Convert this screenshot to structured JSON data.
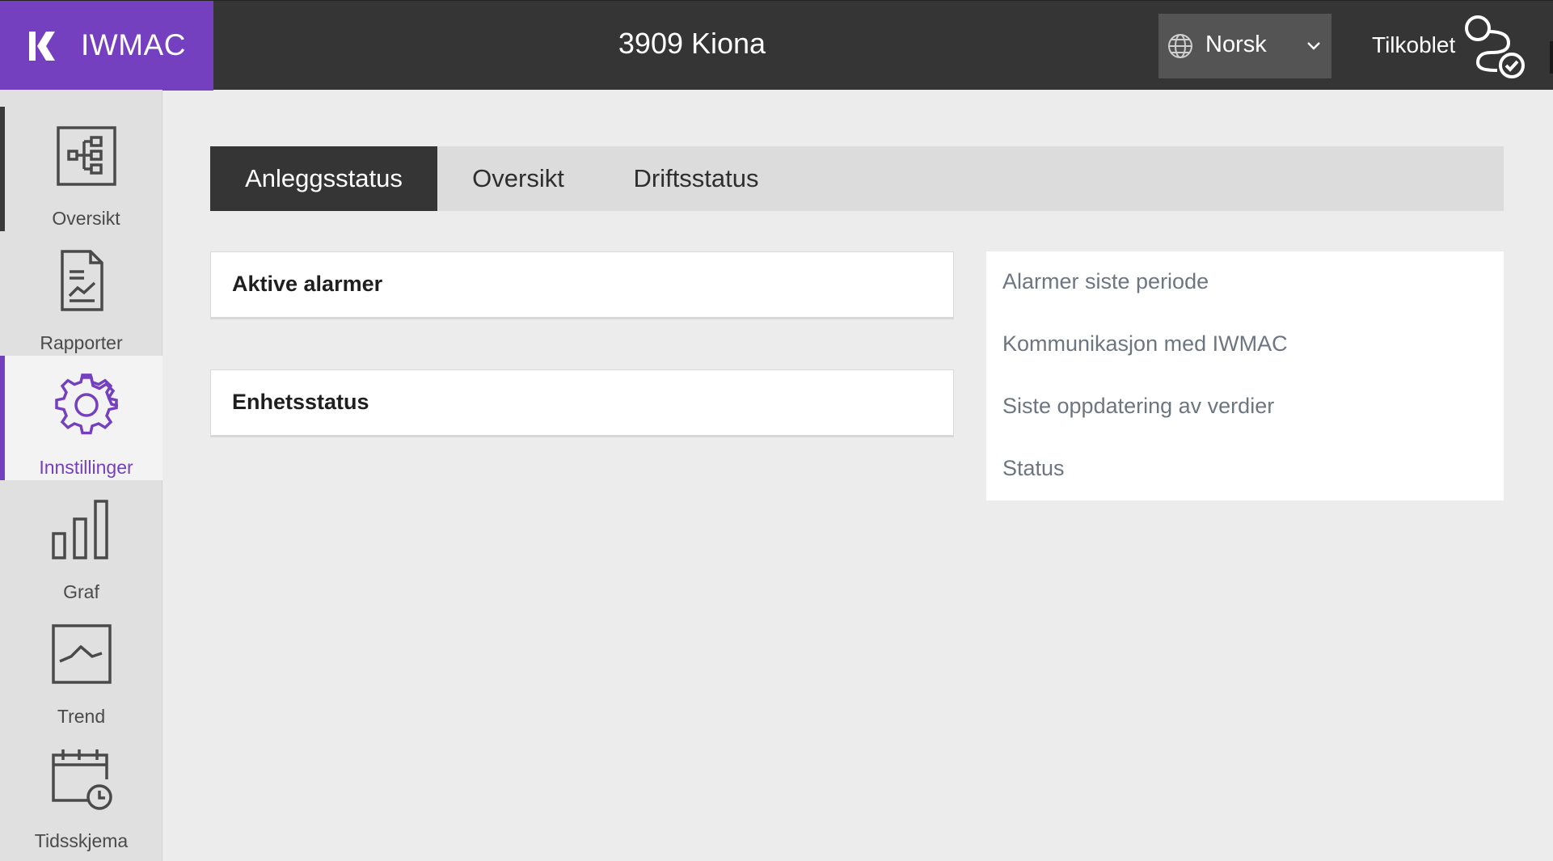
{
  "header": {
    "brand_name": "IWMAC",
    "site_title": "3909 Kiona",
    "language": {
      "selected": "Norsk",
      "icon": "globe-icon"
    },
    "connection": {
      "label": "Tilkoblet",
      "icon": "connected-icon"
    },
    "colors": {
      "brand": "#7440bf",
      "bar": "#353535"
    }
  },
  "sidebar": {
    "items": [
      {
        "label": "Oversikt",
        "icon": "hierarchy-icon",
        "state": "active"
      },
      {
        "label": "Rapporter",
        "icon": "report-icon",
        "state": ""
      },
      {
        "label": "Innstillinger",
        "icon": "gear-icon",
        "state": "selected"
      },
      {
        "label": "Graf",
        "icon": "bar-chart-icon",
        "state": ""
      },
      {
        "label": "Trend",
        "icon": "trend-icon",
        "state": ""
      },
      {
        "label": "Tidsskjema",
        "icon": "calendar-clock-icon",
        "state": ""
      }
    ]
  },
  "tabs": [
    {
      "label": "Anleggsstatus",
      "active": true
    },
    {
      "label": "Oversikt",
      "active": false
    },
    {
      "label": "Driftsstatus",
      "active": false
    }
  ],
  "cards": [
    {
      "title": "Aktive alarmer"
    },
    {
      "title": "Enhetsstatus"
    }
  ],
  "panel": {
    "rows": [
      "Alarmer siste periode",
      "Kommunikasjon med IWMAC",
      "Siste oppdatering av verdier",
      "Status"
    ]
  }
}
